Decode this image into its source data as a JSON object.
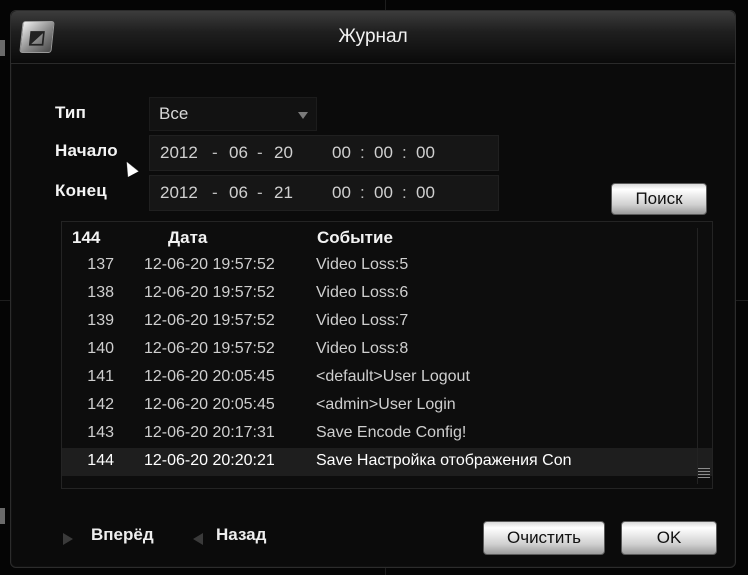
{
  "window": {
    "title": "Журнал"
  },
  "filter": {
    "type_label": "Тип",
    "type_value": "Все",
    "start_label": "Начало",
    "end_label": "Конец",
    "start": {
      "year": "2012",
      "month": "06",
      "day": "20",
      "hour": "00",
      "minute": "00",
      "second": "00"
    },
    "end": {
      "year": "2012",
      "month": "06",
      "day": "21",
      "hour": "00",
      "minute": "00",
      "second": "00"
    },
    "date_separator": "-",
    "time_separator": ":",
    "search_label": "Поиск"
  },
  "log": {
    "header": {
      "count": "144",
      "date": "Дата",
      "event": "Событие"
    },
    "rows": [
      {
        "no": "137",
        "date": "12-06-20 19:57:52",
        "event": "Video Loss:5"
      },
      {
        "no": "138",
        "date": "12-06-20 19:57:52",
        "event": "Video Loss:6"
      },
      {
        "no": "139",
        "date": "12-06-20 19:57:52",
        "event": "Video Loss:7"
      },
      {
        "no": "140",
        "date": "12-06-20 19:57:52",
        "event": "Video Loss:8"
      },
      {
        "no": "141",
        "date": "12-06-20 20:05:45",
        "event": "<default>User Logout"
      },
      {
        "no": "142",
        "date": "12-06-20 20:05:45",
        "event": "<admin>User Login"
      },
      {
        "no": "143",
        "date": "12-06-20 20:17:31",
        "event": "Save Encode Config!"
      },
      {
        "no": "144",
        "date": "12-06-20 20:20:21",
        "event": "Save Настройка отображения Con"
      }
    ],
    "selected_row": "144"
  },
  "footer": {
    "next_label": "Вперёд",
    "prev_label": "Назад",
    "clear_label": "Очистить",
    "ok_label": "OK"
  },
  "colors": {
    "background": "#0b0b0b",
    "text": "#cfcfcf",
    "selected_row": "#1e1e1e",
    "button": "#d9d9d9"
  },
  "icons": {
    "app_logo": "dvr-logo-icon",
    "type_dropdown": "chevron-down-icon",
    "mouse_cursor": "cursor-arrow-icon",
    "next": "arrow-right-icon",
    "prev": "arrow-left-icon"
  }
}
